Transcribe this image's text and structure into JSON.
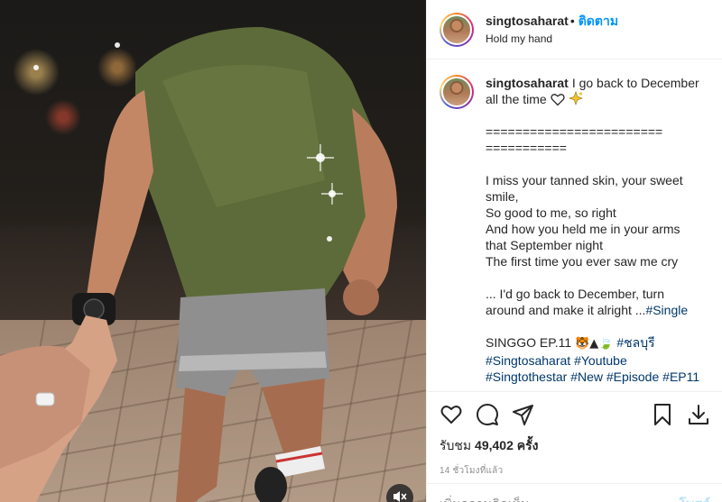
{
  "post": {
    "username": "singtosaharat",
    "separator": "•",
    "follow_label": "ติดตาม",
    "location": "Hold my hand"
  },
  "caption": {
    "username": "singtosaharat",
    "line1": "I go back to December",
    "line2": "all the time",
    "divider1": "========================",
    "divider2": "===========",
    "lyric1": "I miss your tanned skin, your sweet",
    "lyric2": "smile,",
    "lyric3": "So good to me, so right",
    "lyric4": "And how you held me in your arms",
    "lyric5": "that September night",
    "lyric6": "The first time you ever saw me cry",
    "lyric7": "... I'd go back to December, turn",
    "lyric8": "around and make it alright ...",
    "tag_single": "#Single",
    "singgo": "SINGGO EP.11",
    "singgo_emoji": "🐯▲🍃",
    "tag_chonburi": "#ชลบุรี",
    "tag_singtosaharat": "#Singtosaharat",
    "tag_youtube": "#Youtube",
    "tag_singtothestar": "#Singtothestar",
    "tag_new": "#New",
    "tag_episode": "#Episode",
    "tag_ep11": "#EP11"
  },
  "stats": {
    "views_label": "รับชม",
    "views_count": "49,402",
    "views_unit": "ครั้ง",
    "time_ago": "14 ชั่วโมงที่แล้ว"
  },
  "comment_box": {
    "placeholder": "เพิ่มความคิดเห็น...",
    "post_label": "โพสต์"
  },
  "icons": {
    "like": "heart-icon",
    "comment": "comment-icon",
    "share": "share-icon",
    "save": "bookmark-icon",
    "download": "download-icon",
    "mute": "speaker-muted-icon"
  },
  "colors": {
    "accent": "#0095f6",
    "hashtag": "#00376b",
    "muted_text": "#8e8e8e",
    "border": "#efefef"
  }
}
